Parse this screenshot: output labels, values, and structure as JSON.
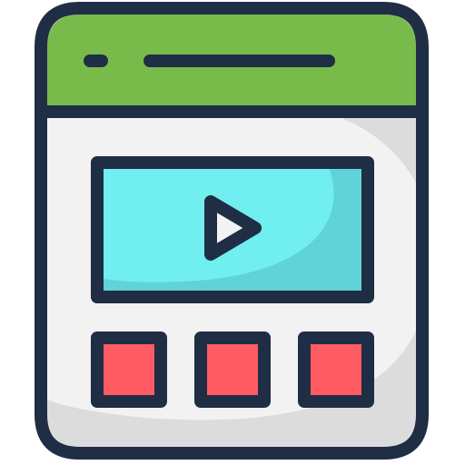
{
  "icon": {
    "semantic_name": "video-webpage-icon",
    "colors": {
      "outline": "#1f2d45",
      "window_body": "#f2f2f2",
      "window_shadow": "#dcdcdc",
      "title_bar": "#79bb4b",
      "video_screen": "#70eef0",
      "video_screen_shade": "#5fd3d8",
      "play_triangle": "#f2f2f2",
      "thumbnail": "#ff5b62"
    },
    "thumbnail_count": 3
  }
}
